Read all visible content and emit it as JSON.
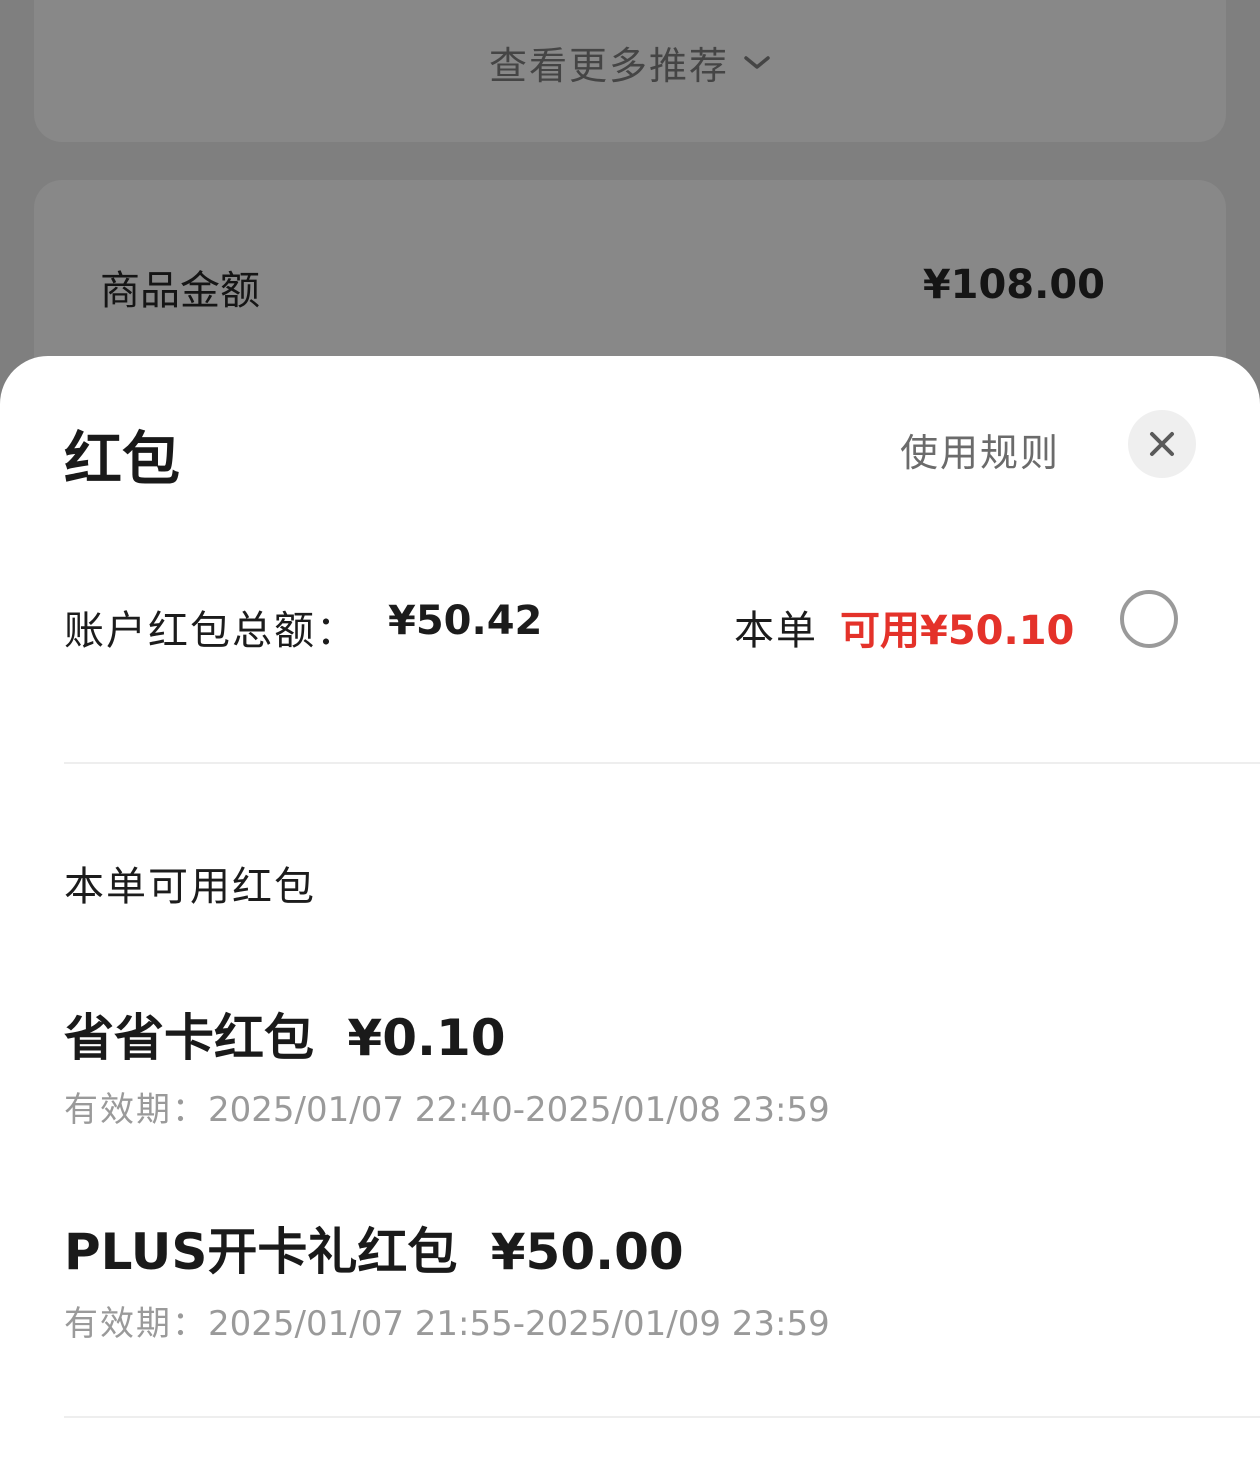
{
  "background": {
    "more_recommendations": "查看更多推荐",
    "amount_label": "商品金额",
    "amount_value": "¥108.00"
  },
  "sheet": {
    "title": "红包",
    "rules_link": "使用规则",
    "account_total_label": "账户红包总额：",
    "account_total_value": "¥50.42",
    "order_label": "本单",
    "order_available": "可用¥50.10",
    "section_title": "本单可用红包",
    "coupons": [
      {
        "name": "省省卡红包",
        "amount": "¥0.10",
        "validity_label": "有效期：",
        "validity": "2025/01/07 22:40-2025/01/08 23:59"
      },
      {
        "name": "PLUS开卡礼红包",
        "amount": "¥50.00",
        "validity_label": "有效期：",
        "validity": "2025/01/07 21:55-2025/01/09 23:59"
      }
    ]
  },
  "colors": {
    "accent_red": "#e4322a",
    "overlay": "#7f7f7f"
  },
  "icons": {
    "close": "close-icon",
    "chevron": "chevron-down-icon"
  }
}
